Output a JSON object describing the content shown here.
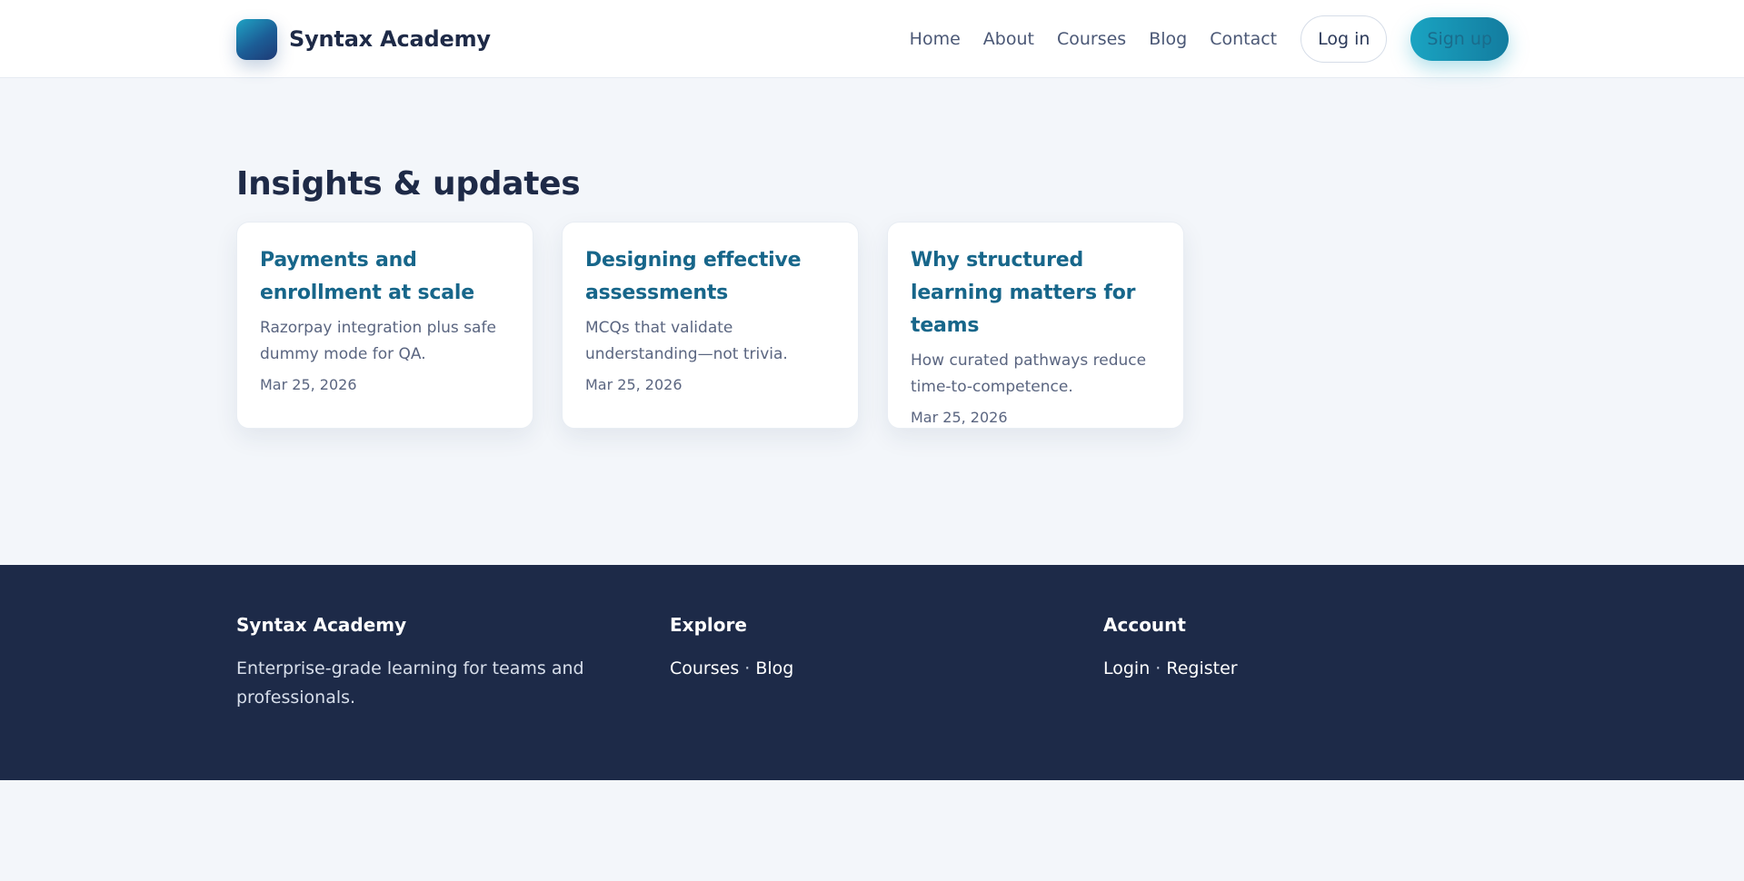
{
  "header": {
    "brand_name": "Syntax Academy",
    "nav": [
      {
        "label": "Home"
      },
      {
        "label": "About"
      },
      {
        "label": "Courses"
      },
      {
        "label": "Blog"
      },
      {
        "label": "Contact"
      }
    ],
    "login_label": "Log in",
    "signup_label": "Sign up"
  },
  "main": {
    "section_title": "Insights & updates",
    "posts": [
      {
        "title": "Payments and enrollment at scale",
        "excerpt": "Razorpay integration plus safe dummy mode for QA.",
        "date": "Mar 25, 2026"
      },
      {
        "title": "Designing effective assessments",
        "excerpt": "MCQs that validate understanding—not trivia.",
        "date": "Mar 25, 2026"
      },
      {
        "title": "Why structured learning matters for teams",
        "excerpt": "How curated pathways reduce time-to-competence.",
        "date": "Mar 25, 2026"
      }
    ]
  },
  "footer": {
    "col1": {
      "heading": "Syntax Academy",
      "text": "Enterprise-grade learning for teams and professionals."
    },
    "col2": {
      "heading": "Explore",
      "links": [
        "Courses",
        "Blog"
      ]
    },
    "col3": {
      "heading": "Account",
      "links": [
        "Login",
        "Register"
      ]
    },
    "separator": " · "
  },
  "colors": {
    "accent": "#17668a",
    "brand_gradient_start": "#1fa3c4",
    "brand_gradient_end": "#1e3a75",
    "footer_bg": "#1d2a48",
    "page_bg": "#f3f6fa"
  },
  "icons": {
    "brand_logo": "brand-logo-icon"
  }
}
